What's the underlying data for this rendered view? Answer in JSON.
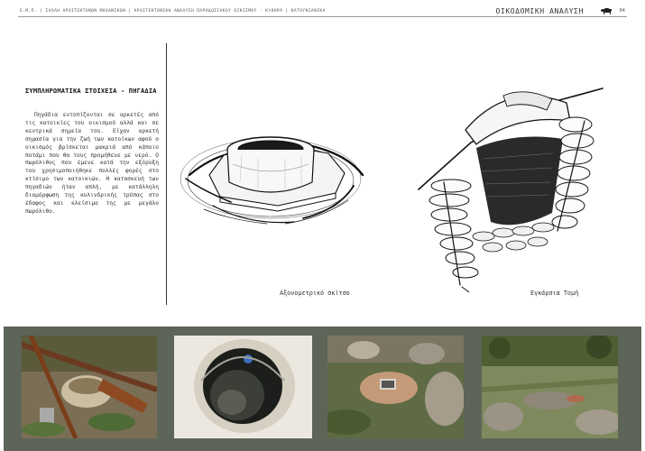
{
  "header": {
    "breadcrumb": "Ε.Μ.Π. | ΣΧΟΛΗ ΑΡΧΙΤΕΚΤΟΝΩΝ ΜΗΧΑΝΙΚΩΝ | ΑΡΧΙΤΕΚΤΟΝΙΚΗ ΑΝΑΛΥΣΗ ΠΑΡΑΔΟΣΙΑΚΟΥ ΟΙΚΙΣΜΟΥ - ΚΥΘΗΡΑ | ΚΑΤΟΥΝΙΑΝΙΚΑ",
    "section": "ΟΙΚΟΔΟΜΙΚΗ ΑΝΑΛΥΣΗ",
    "icon": "animal-silhouette-icon",
    "page_number": "94"
  },
  "content": {
    "title": "ΣΥΜΠΛΗΡΩΜΑΤΙΚΑ ΣΤΟΙΧΕΙΑ - ΠΗΓΑΔΙΑ",
    "paragraph": "Πηγάδια εντοπίζονται σε αρκετές από τις κατοικίες του οικισμού αλλά και σε κεντρικά σημεία του. Είχαν αρκετή σημασία για την ζωή των κατοίκων αφού ο οικισμός βρίσκεται μακριά από κάποιο ποτάμι που θα τους προμήθευε με νερό. Ο πωρόλιθος που έμενε κατά την εξόρυξη του χρησιμοποιήθηκε πολλές φορές στο κτίσιμο των κατοικιών. Η κατασκευή των πηγαδιών ήταν απλή, με κατάλληλη διαμόρφωση της κυλινδρικής τρύπας στο έδαφος και κλείσιμο της με μεγάλο πωρόλιθο."
  },
  "figures": {
    "axonometric_caption": "Αξονομετρικό σκίτσο",
    "section_caption": "Εγκάρσια Τομή"
  },
  "colors": {
    "strip": "#5d6558"
  }
}
